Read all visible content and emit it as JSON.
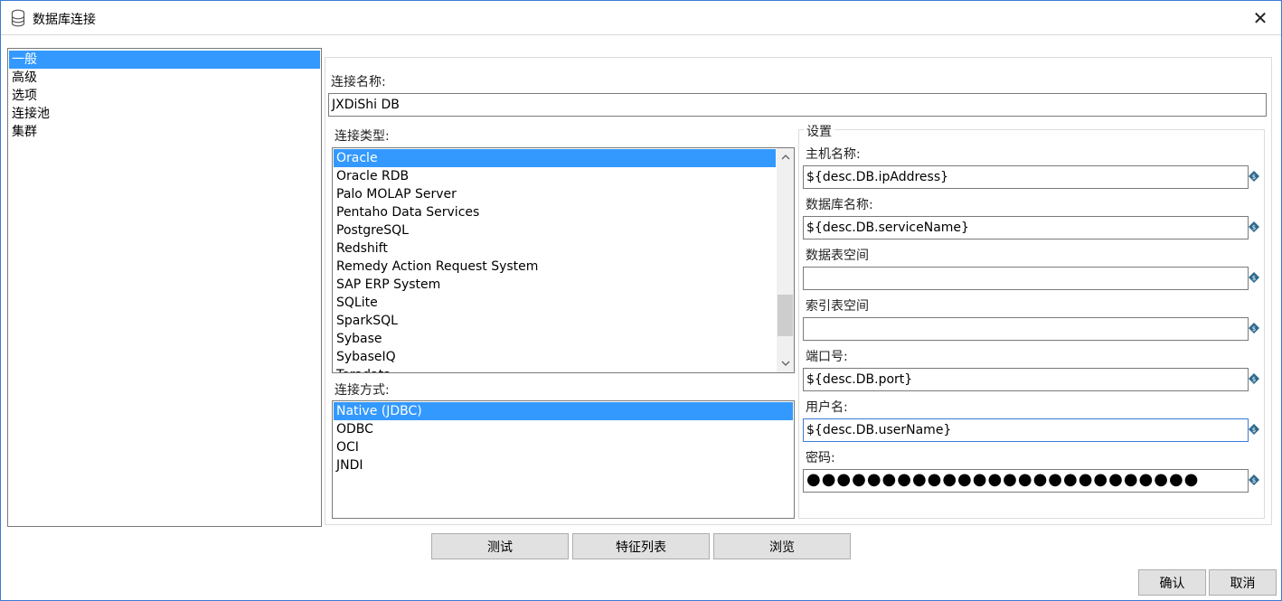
{
  "window": {
    "title": "数据库连接",
    "close_glyph": "✕"
  },
  "nav": {
    "items": [
      {
        "label": "一般",
        "selected": true
      },
      {
        "label": "高级",
        "selected": false
      },
      {
        "label": "选项",
        "selected": false
      },
      {
        "label": "连接池",
        "selected": false
      },
      {
        "label": "集群",
        "selected": false
      }
    ]
  },
  "connection_name": {
    "label": "连接名称:",
    "value": "JXDiShi DB"
  },
  "connection_type": {
    "label": "连接类型:",
    "items": [
      {
        "label": "Oracle",
        "selected": true
      },
      {
        "label": "Oracle RDB",
        "selected": false
      },
      {
        "label": "Palo MOLAP Server",
        "selected": false
      },
      {
        "label": "Pentaho Data Services",
        "selected": false
      },
      {
        "label": "PostgreSQL",
        "selected": false
      },
      {
        "label": "Redshift",
        "selected": false
      },
      {
        "label": "Remedy Action Request System",
        "selected": false
      },
      {
        "label": "SAP ERP System",
        "selected": false
      },
      {
        "label": "SQLite",
        "selected": false
      },
      {
        "label": "SparkSQL",
        "selected": false
      },
      {
        "label": "Sybase",
        "selected": false
      },
      {
        "label": "SybaseIQ",
        "selected": false
      },
      {
        "label": "Teradata",
        "selected": false
      }
    ]
  },
  "access_method": {
    "label": "连接方式:",
    "items": [
      {
        "label": "Native (JDBC)",
        "selected": true
      },
      {
        "label": "ODBC",
        "selected": false
      },
      {
        "label": "OCI",
        "selected": false
      },
      {
        "label": "JNDI",
        "selected": false
      }
    ]
  },
  "settings": {
    "title": "设置",
    "fields": [
      {
        "label": "主机名称:",
        "value": "${desc.DB.ipAddress}"
      },
      {
        "label": "数据库名称:",
        "value": "${desc.DB.serviceName}"
      },
      {
        "label": "数据表空间",
        "value": ""
      },
      {
        "label": "索引表空间",
        "value": ""
      },
      {
        "label": "端口号:",
        "value": "${desc.DB.port}"
      },
      {
        "label": "用户名:",
        "value": "${desc.DB.userName}"
      },
      {
        "label": "密码:",
        "value": "●●●●●●●●●●●●●●●●●●●●●●●●●●"
      }
    ]
  },
  "buttons": {
    "test": "测试",
    "features": "特征列表",
    "explore": "浏览",
    "ok": "确认",
    "cancel": "取消"
  },
  "colors": {
    "selection": "#3399ff",
    "variable_icon": "#2d6a8f"
  }
}
